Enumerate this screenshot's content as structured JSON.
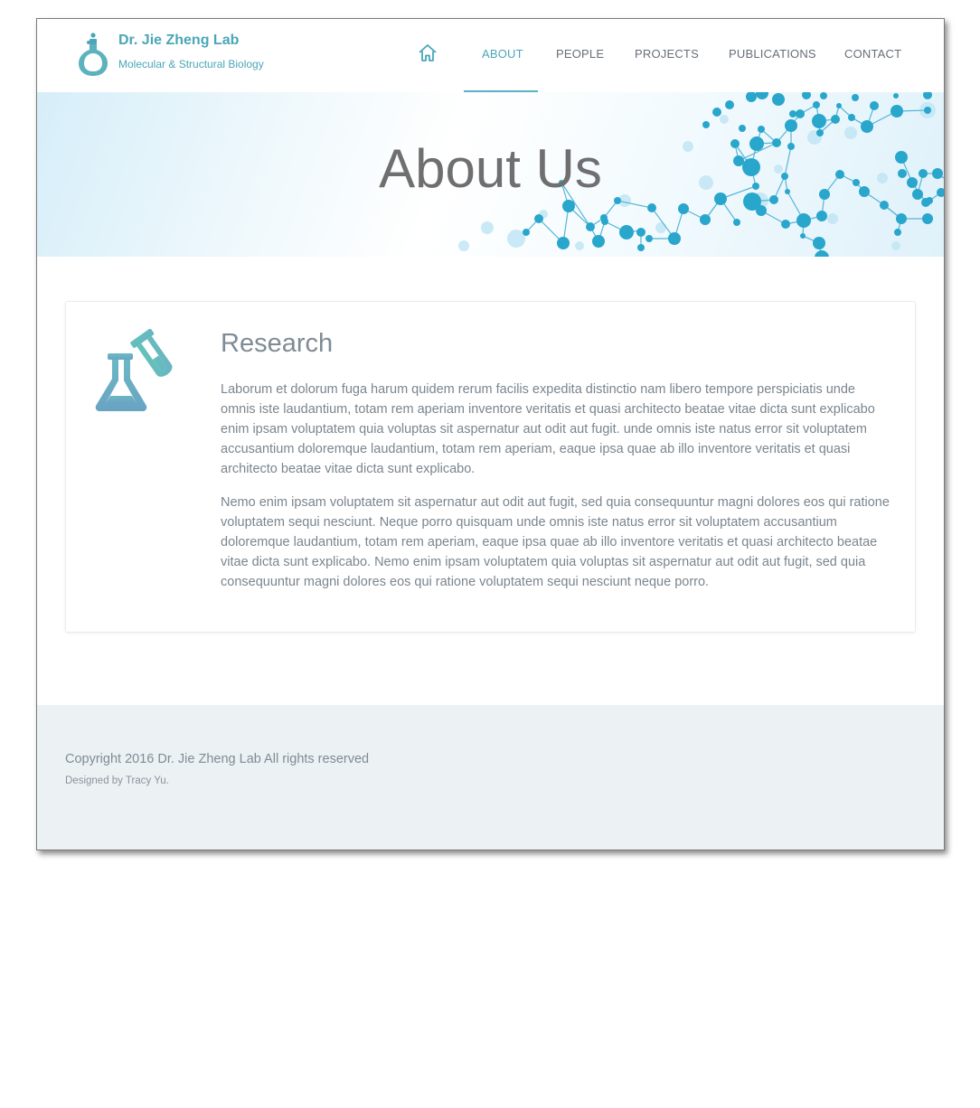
{
  "header": {
    "brand_title": "Dr. Jie Zheng Lab",
    "brand_subtitle": "Molecular & Structural Biology",
    "logo_icon": "flask-logo-icon",
    "home_icon": "home-icon"
  },
  "nav": {
    "items": [
      {
        "label": "ABOUT",
        "active": true
      },
      {
        "label": "PEOPLE",
        "active": false
      },
      {
        "label": "PROJECTS",
        "active": false
      },
      {
        "label": "PUBLICATIONS",
        "active": false
      },
      {
        "label": "CONTACT",
        "active": false
      }
    ]
  },
  "hero": {
    "title": "About Us"
  },
  "research": {
    "icon": "lab-flask-test-tube-icon",
    "title": "Research",
    "paragraphs": [
      "Laborum et dolorum fuga harum quidem rerum facilis expedita distinctio nam libero tempore perspiciatis unde omnis iste laudantium, totam rem aperiam inventore veritatis et quasi architecto beatae vitae dicta sunt explicabo enim ipsam voluptatem quia voluptas sit aspernatur aut odit aut fugit. unde omnis iste natus error sit voluptatem accusantium doloremque laudantium, totam rem aperiam, eaque ipsa quae ab illo inventore veritatis et quasi architecto beatae vitae dicta sunt explicabo.",
      "Nemo enim ipsam voluptatem sit aspernatur aut odit aut fugit, sed quia consequuntur magni dolores eos qui ratione voluptatem sequi nesciunt. Neque porro quisquam unde omnis iste natus error sit voluptatem accusantium doloremque laudantium, totam rem aperiam, eaque ipsa quae ab illo inventore veritatis et quasi architecto beatae vitae dicta sunt explicabo. Nemo enim ipsam voluptatem quia voluptas sit aspernatur aut odit aut fugit, sed quia consequuntur magni dolores eos qui ratione voluptatem sequi nesciunt neque porro."
    ]
  },
  "footer": {
    "copyright": "Copyright 2016 Dr. Jie Zheng Lab All rights reserved",
    "designed_by": "Designed by Tracy Yu."
  },
  "colors": {
    "accent": "#4aa6b8",
    "icon_teal": "#5cc0b5",
    "icon_blue": "#68a9c4",
    "molecule": "#29a6cc",
    "footer_bg": "#ecf1f4"
  }
}
